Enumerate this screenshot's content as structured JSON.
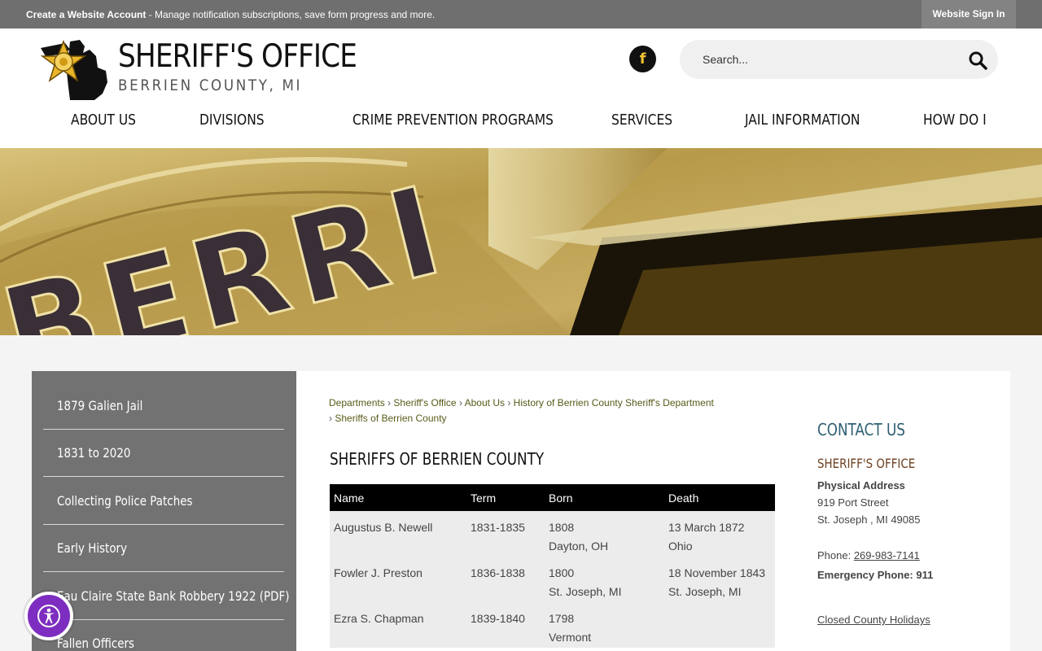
{
  "topbar": {
    "account_link": "Create a Website Account",
    "account_text": " - Manage notification subscriptions, save form progress and more.",
    "signin": "Website Sign In"
  },
  "header": {
    "title": "SHERIFF'S OFFICE",
    "subtitle": "BERRIEN COUNTY, MI",
    "facebook_glyph": "f",
    "search_placeholder": "Search...",
    "icons": [
      "sheriff-badge-icon",
      "facebook-icon",
      "search-icon"
    ]
  },
  "nav": [
    {
      "label": "ABOUT US"
    },
    {
      "label": "DIVISIONS"
    },
    {
      "label": "CRIME PREVENTION PROGRAMS"
    },
    {
      "label": "SERVICES"
    },
    {
      "label": "JAIL INFORMATION"
    },
    {
      "label": "HOW DO I"
    }
  ],
  "hero": {
    "badge_text": "BERRI"
  },
  "sidebar": [
    {
      "label": "1879 Galien Jail"
    },
    {
      "label": "1831 to 2020"
    },
    {
      "label": "Collecting Police Patches"
    },
    {
      "label": "Early History"
    },
    {
      "label": "Eau Claire State Bank Robbery 1922 (PDF)"
    },
    {
      "label": "Fallen Officers"
    }
  ],
  "breadcrumb": [
    {
      "label": "Departments"
    },
    {
      "label": "Sheriff's Office"
    },
    {
      "label": "About Us"
    },
    {
      "label": "History of Berrien County Sheriff's Department"
    },
    {
      "label": "Sheriffs of Berrien County"
    }
  ],
  "breadcrumb_separator": "›",
  "page_title": "SHERIFFS OF BERRIEN COUNTY",
  "table": {
    "headers": [
      "Name",
      "Term",
      "Born",
      "Death"
    ],
    "rows": [
      {
        "name": "Augustus B. Newell",
        "term": "1831-1835",
        "born_year": "1808",
        "born_place": "Dayton, OH",
        "death_date": "13 March 1872",
        "death_place": "Ohio"
      },
      {
        "name": "Fowler J. Preston",
        "term": "1836-1838",
        "born_year": "1800",
        "born_place": "St. Joseph, MI",
        "death_date": "18 November 1843",
        "death_place": "St. Joseph, MI"
      },
      {
        "name": "Ezra S. Chapman",
        "term": "1839-1840",
        "born_year": "1798",
        "born_place": "Vermont",
        "death_date": "",
        "death_place": ""
      }
    ]
  },
  "contact": {
    "heading": "CONTACT US",
    "office": "SHERIFF'S OFFICE",
    "address_label": "Physical Address",
    "street": "919 Port Street",
    "city": "St. Joseph , MI 49085",
    "phone_label": "Phone: ",
    "phone": "269-983-7141",
    "emergency": "Emergency Phone: 911",
    "holidays_link": "Closed County Holidays"
  },
  "colors": {
    "topbar": "#6f6f6f",
    "sidebar": "#727272",
    "contact_heading": "#2e5f73",
    "office_heading": "#6d4020",
    "accessibility": "#7d2dbf",
    "facebook_glyph": "#f2c232"
  },
  "accessibility_icon": "accessibility-person-icon"
}
